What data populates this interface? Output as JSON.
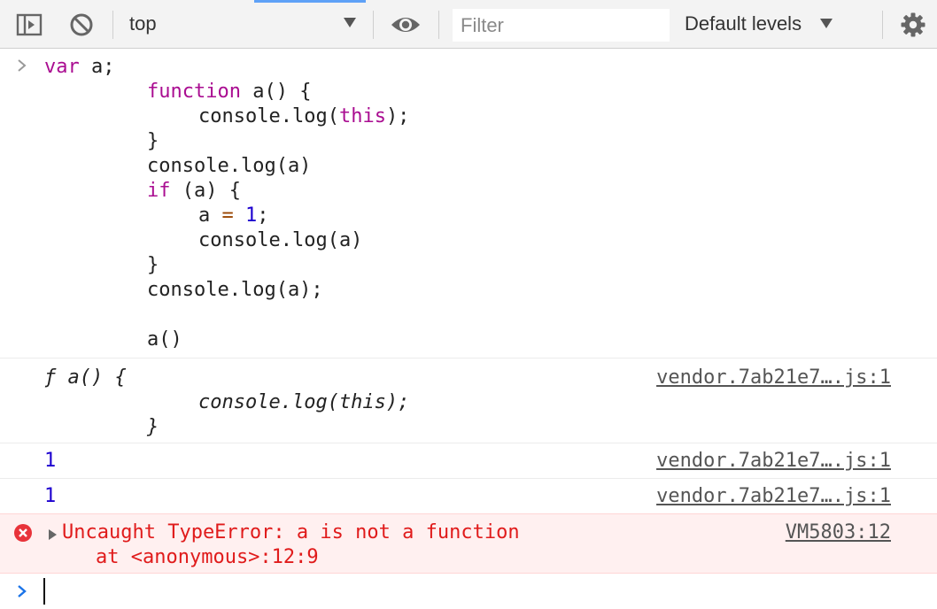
{
  "toolbar": {
    "context": "top",
    "filter_placeholder": "Filter",
    "levels_label": "Default levels"
  },
  "input_code": {
    "l1_kw": "var",
    "l1_rest": " a;",
    "l2_kw": "function",
    "l2_rest": " a() {",
    "l3_obj": "console.log(",
    "l3_this": "this",
    "l3_end": ");",
    "l4": "}",
    "l5": "console.log(a)",
    "l6_kw": "if",
    "l6_rest": " (a) {",
    "l7_a": "a ",
    "l7_eq": "=",
    "l7_sp": " ",
    "l7_num": "1",
    "l7_end": ";",
    "l8": "console.log(a)",
    "l9": "}",
    "l10": "console.log(a);",
    "l11": "a()"
  },
  "outputs": {
    "fn_line1": "ƒ a() {",
    "fn_line2": "console.log(this);",
    "fn_line3": "}",
    "fn_source": "vendor.7ab21e7….js:1",
    "out1_value": "1",
    "out1_source": "vendor.7ab21e7….js:1",
    "out2_value": "1",
    "out2_source": "vendor.7ab21e7….js:1"
  },
  "error": {
    "message": "Uncaught TypeError: a is not a function",
    "trace": "at <anonymous>:12:9",
    "source": "VM5803:12"
  },
  "colors": {
    "keyword": "#aa0d91",
    "number": "#1c00cf",
    "error": "#e01b1b",
    "error_bg": "#fff0f0",
    "prompt": "#1a73e8"
  }
}
